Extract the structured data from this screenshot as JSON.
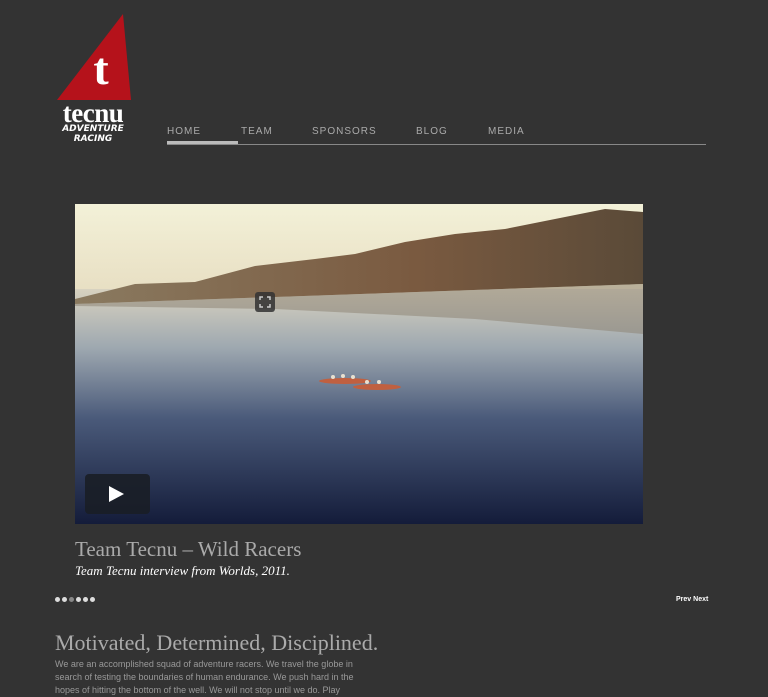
{
  "brand": {
    "logo_letter": "t",
    "name": "tecnu",
    "tagline_1": "ADVENTURE",
    "tagline_2": "RACING",
    "red": "#b5121b"
  },
  "nav": {
    "items": [
      {
        "label": "HOME",
        "active": true
      },
      {
        "label": "TEAM",
        "active": false
      },
      {
        "label": "SPONSORS",
        "active": false
      },
      {
        "label": "BLOG",
        "active": false
      },
      {
        "label": "MEDIA",
        "active": false
      }
    ]
  },
  "video": {
    "play_icon": "play-icon",
    "fullscreen_icon": "fullscreen-icon"
  },
  "slide": {
    "title": "Team Tecnu – Wild Racers",
    "subtitle": "Team Tecnu interview from Worlds, 2011.",
    "dot_count": 6,
    "current_dot": 3,
    "prev_label": "Prev",
    "next_label": "Next"
  },
  "content": {
    "headline": "Motivated, Determined, Disciplined.",
    "body": "We are an accomplished squad of adventure racers. We travel the globe in search of testing the boundaries of human endurance. We push hard in the hopes of hitting the bottom of the well. We will not stop until we do. Play"
  }
}
